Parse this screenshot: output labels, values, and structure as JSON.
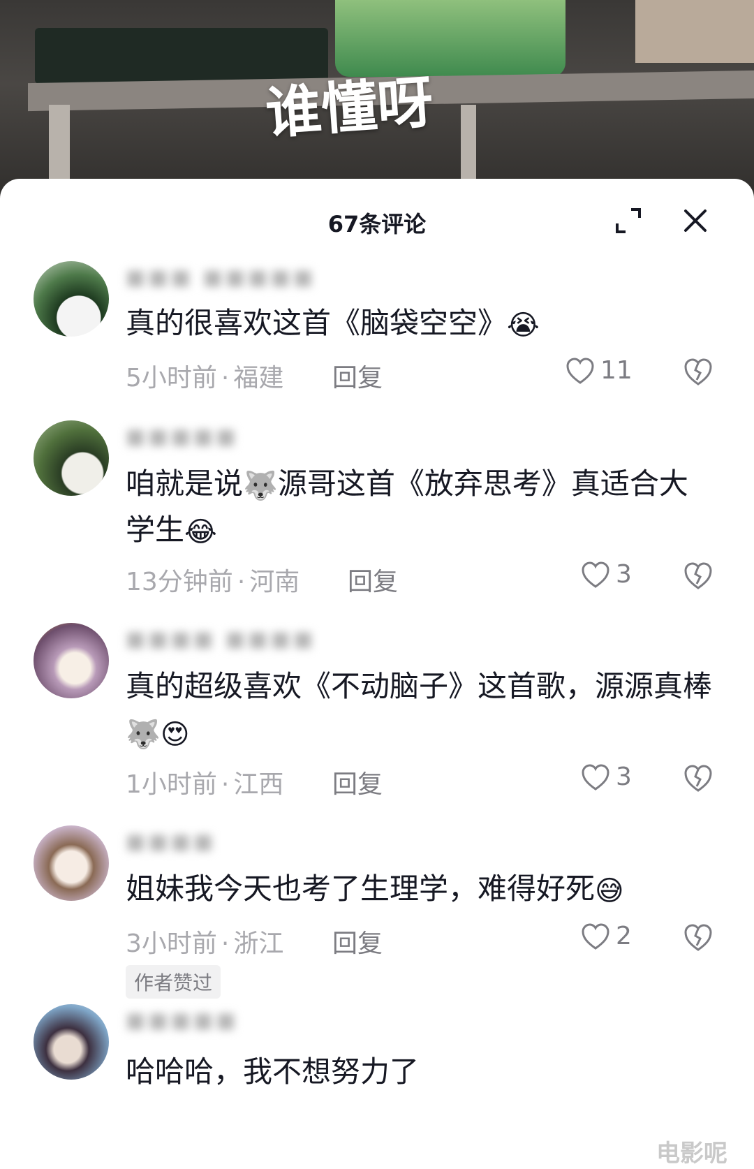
{
  "video": {
    "caption": "谁懂呀"
  },
  "header": {
    "title": "67条评论",
    "expand_icon": "expand-icon",
    "close_icon": "close-icon"
  },
  "comments": [
    {
      "username": "■■■ ■■■■■",
      "text": "真的很喜欢这首《脑袋空空》",
      "emojis": [
        "😭"
      ],
      "time": "5小时前",
      "location": "福建",
      "reply": "回复",
      "likes": "11"
    },
    {
      "username": "■■■■■",
      "text": "咱就是说",
      "text2": "源哥这首《放弃思考》真适合大学生",
      "emojis": [
        "🐺",
        "😂"
      ],
      "time": "13分钟前",
      "location": "河南",
      "reply": "回复",
      "likes": "3"
    },
    {
      "username": "■■■■  ■■■■",
      "text": "真的超级喜欢《不动脑子》这首歌，源源真棒",
      "emojis": [
        "🐺",
        "😍"
      ],
      "time": "1小时前",
      "location": "江西",
      "reply": "回复",
      "likes": "3"
    },
    {
      "username": "■■■■",
      "text": "姐妹我今天也考了生理学，难得好死",
      "emojis": [
        "😅"
      ],
      "time": "3小时前",
      "location": "浙江",
      "reply": "回复",
      "likes": "2",
      "badge": "作者赞过"
    },
    {
      "username": "■■■■■",
      "text": "哈哈哈，我不想努力了"
    }
  ],
  "watermark": "电影呢"
}
